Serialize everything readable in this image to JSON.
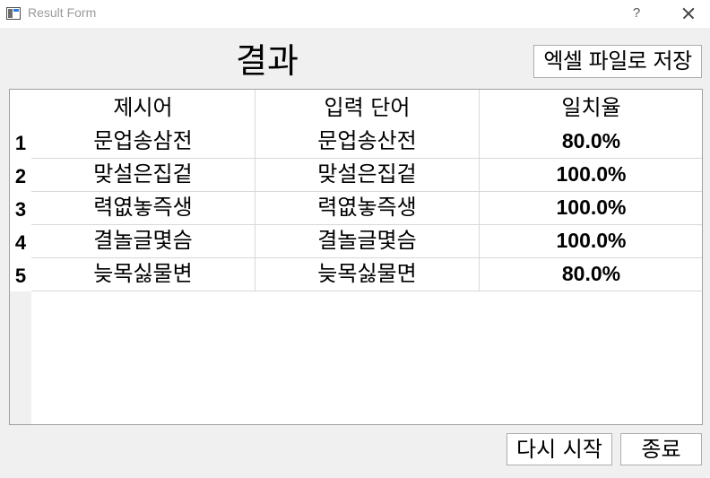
{
  "window": {
    "title": "Result Form",
    "help_label": "?"
  },
  "heading": "결과",
  "buttons": {
    "export": "엑셀 파일로 저장",
    "restart": "다시 시작",
    "quit": "종료"
  },
  "table": {
    "columns": [
      "제시어",
      "입력 단어",
      "일치율"
    ],
    "rows": [
      {
        "num": "1",
        "prompt": "문업송삼전",
        "input": "문업송산전",
        "match": "80.0%"
      },
      {
        "num": "2",
        "prompt": "맞설은집겉",
        "input": "맞설은집겉",
        "match": "100.0%"
      },
      {
        "num": "3",
        "prompt": "력엾놓즉생",
        "input": "력엾놓즉생",
        "match": "100.0%"
      },
      {
        "num": "4",
        "prompt": "결놀글몇슴",
        "input": "결놀글몇슴",
        "match": "100.0%"
      },
      {
        "num": "5",
        "prompt": "늦목싫물변",
        "input": "늦목싫물면",
        "match": "80.0%"
      }
    ]
  }
}
